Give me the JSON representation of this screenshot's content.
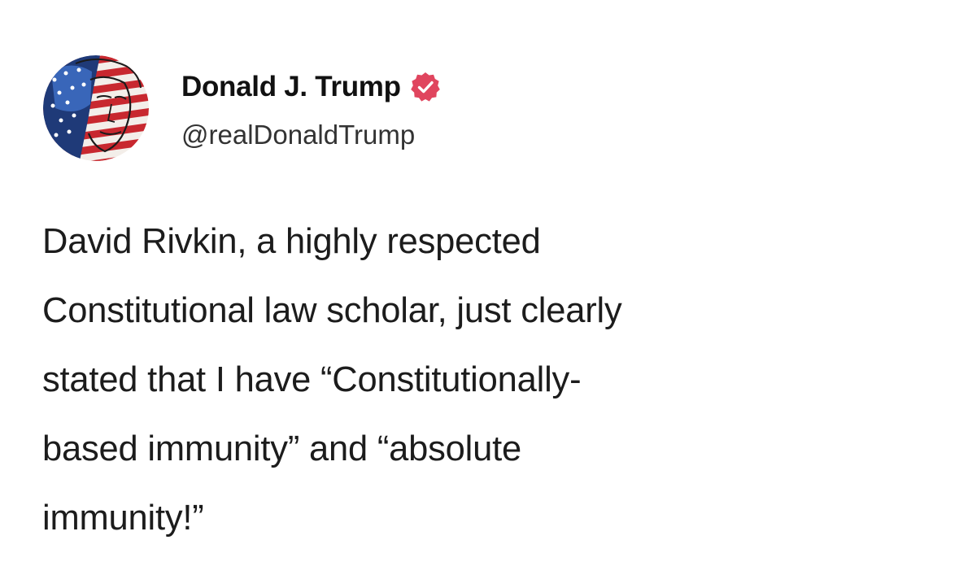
{
  "author": {
    "display_name": "Donald J. Trump",
    "handle": "@realDonaldTrump",
    "verified": true,
    "avatar_icon": "flag-portrait-avatar",
    "badge_icon": "verified-badge-icon",
    "badge_color": "#e0455e"
  },
  "post": {
    "lines": [
      "David Rivkin, a highly respected",
      "Constitutional law scholar, just clearly",
      "stated that I have “Constitutionally-",
      "based immunity” and “absolute",
      "immunity!”"
    ]
  }
}
